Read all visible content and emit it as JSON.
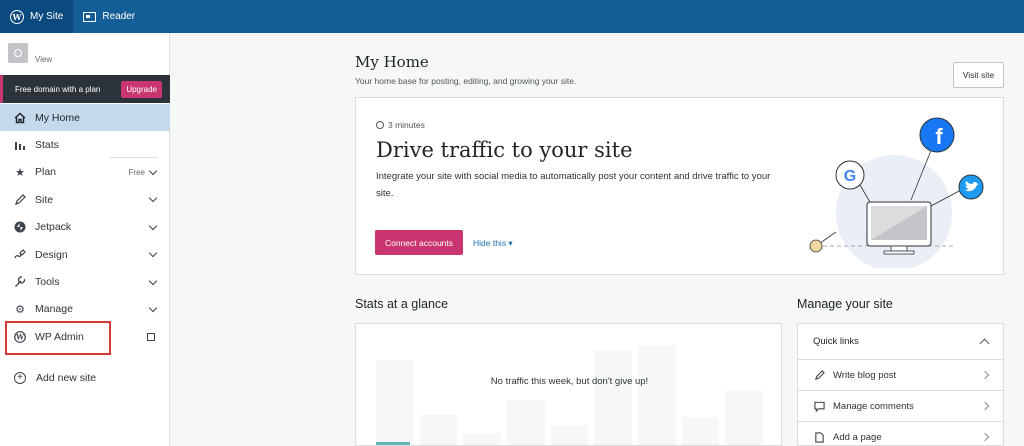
{
  "topbar": {
    "my_site_label": "My Site",
    "reader_label": "Reader"
  },
  "site": {
    "view_label": "View"
  },
  "promo": {
    "text": "Free domain with a plan",
    "upgrade_label": "Upgrade"
  },
  "sidebar": {
    "items": [
      {
        "label": "My Home",
        "icon": "home-icon"
      },
      {
        "label": "Stats",
        "icon": "stats-icon"
      },
      {
        "label": "Plan",
        "icon": "star-icon",
        "badge": "Free"
      },
      {
        "label": "Site",
        "icon": "pencil-icon"
      },
      {
        "label": "Jetpack",
        "icon": "jetpack-icon"
      },
      {
        "label": "Design",
        "icon": "design-icon"
      },
      {
        "label": "Tools",
        "icon": "wrench-icon"
      },
      {
        "label": "Manage",
        "icon": "gear-icon"
      },
      {
        "label": "WP Admin",
        "icon": "wordpress-icon"
      }
    ],
    "add_site_label": "Add new site"
  },
  "main": {
    "title": "My Home",
    "subtitle": "Your home base for posting, editing, and growing your site.",
    "visit_site_label": "Visit site"
  },
  "task_card": {
    "time": "3 minutes",
    "title": "Drive traffic to your site",
    "description": "Integrate your site with social media to automatically post your content and drive traffic to your site.",
    "connect_label": "Connect accounts",
    "hide_label": "Hide this ▾"
  },
  "stats": {
    "title": "Stats at a glance",
    "message": "No traffic this week, but don't give up!"
  },
  "manage": {
    "title": "Manage your site",
    "quick_links_label": "Quick links",
    "links": [
      {
        "label": "Write blog post",
        "icon": "pencil-icon"
      },
      {
        "label": "Manage comments",
        "icon": "comment-icon"
      },
      {
        "label": "Add a page",
        "icon": "page-icon"
      }
    ]
  },
  "colors": {
    "topbar": "#135e96",
    "accent": "#c9356e",
    "active_nav": "#c5d9ed",
    "highlight_box": "#d63638"
  }
}
